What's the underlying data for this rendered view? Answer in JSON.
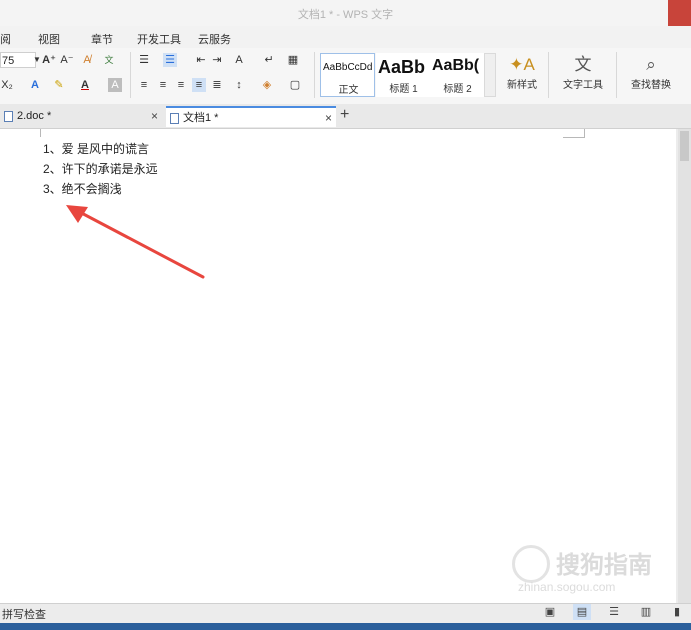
{
  "window": {
    "title": "文档1 * - WPS 文字"
  },
  "menu": [
    "阅",
    "视图",
    "章节",
    "开发工具",
    "云服务"
  ],
  "ribbon": {
    "font_size": "75",
    "styles": [
      {
        "sample": "AaBbCcDd",
        "label": "正文"
      },
      {
        "sample": "AaBb",
        "label": "标题 1"
      },
      {
        "sample": "AaBb(",
        "label": "标题 2"
      }
    ],
    "new_style_label": "新样式",
    "text_tools_label": "文字工具",
    "find_replace_label": "查找替换"
  },
  "tabs": [
    {
      "label": "2.doc *"
    },
    {
      "label": "文档1 *"
    }
  ],
  "document": {
    "lines": [
      "1、爱 是风中的谎言",
      "2、许下的承诺是永远",
      "3、绝不会搁浅"
    ]
  },
  "status": {
    "spell_check": "拼写检查"
  },
  "watermark": {
    "text": "搜狗指南",
    "sub": "zhinan.sogou.com"
  },
  "colors": {
    "annotation_arrow": "#e8463e",
    "accent": "#4a8be0"
  }
}
